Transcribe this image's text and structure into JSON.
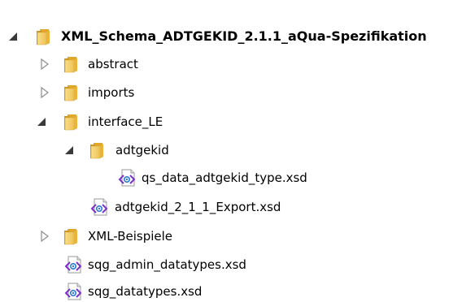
{
  "tree": {
    "root": {
      "label": "XML_Schema_ADTGEKID_2.1.1_aQua-Spezifikation",
      "icon": "folder-icon",
      "expanded": true
    },
    "items": [
      {
        "label": "abstract",
        "icon": "folder-icon",
        "expanded": false
      },
      {
        "label": "imports",
        "icon": "folder-icon",
        "expanded": false
      },
      {
        "label": "interface_LE",
        "icon": "folder-icon",
        "expanded": true
      },
      {
        "label": "adtgekid",
        "icon": "folder-icon",
        "expanded": true
      },
      {
        "label": "qs_data_adtgekid_type.xsd",
        "icon": "xsd-file-icon"
      },
      {
        "label": "adtgekid_2_1_1_Export.xsd",
        "icon": "xsd-file-icon"
      },
      {
        "label": "XML-Beispiele",
        "icon": "folder-icon",
        "expanded": false
      },
      {
        "label": "sqg_admin_datatypes.xsd",
        "icon": "xsd-file-icon"
      },
      {
        "label": "sqg_datatypes.xsd",
        "icon": "xsd-file-icon"
      }
    ]
  },
  "colors": {
    "folder_front": "#f5cf6a",
    "folder_back": "#e3ab2e",
    "toggle_collapsed": "#8c8c8c",
    "toggle_expanded": "#3a3a3a",
    "xsd_accent": "#7a2fc9"
  }
}
